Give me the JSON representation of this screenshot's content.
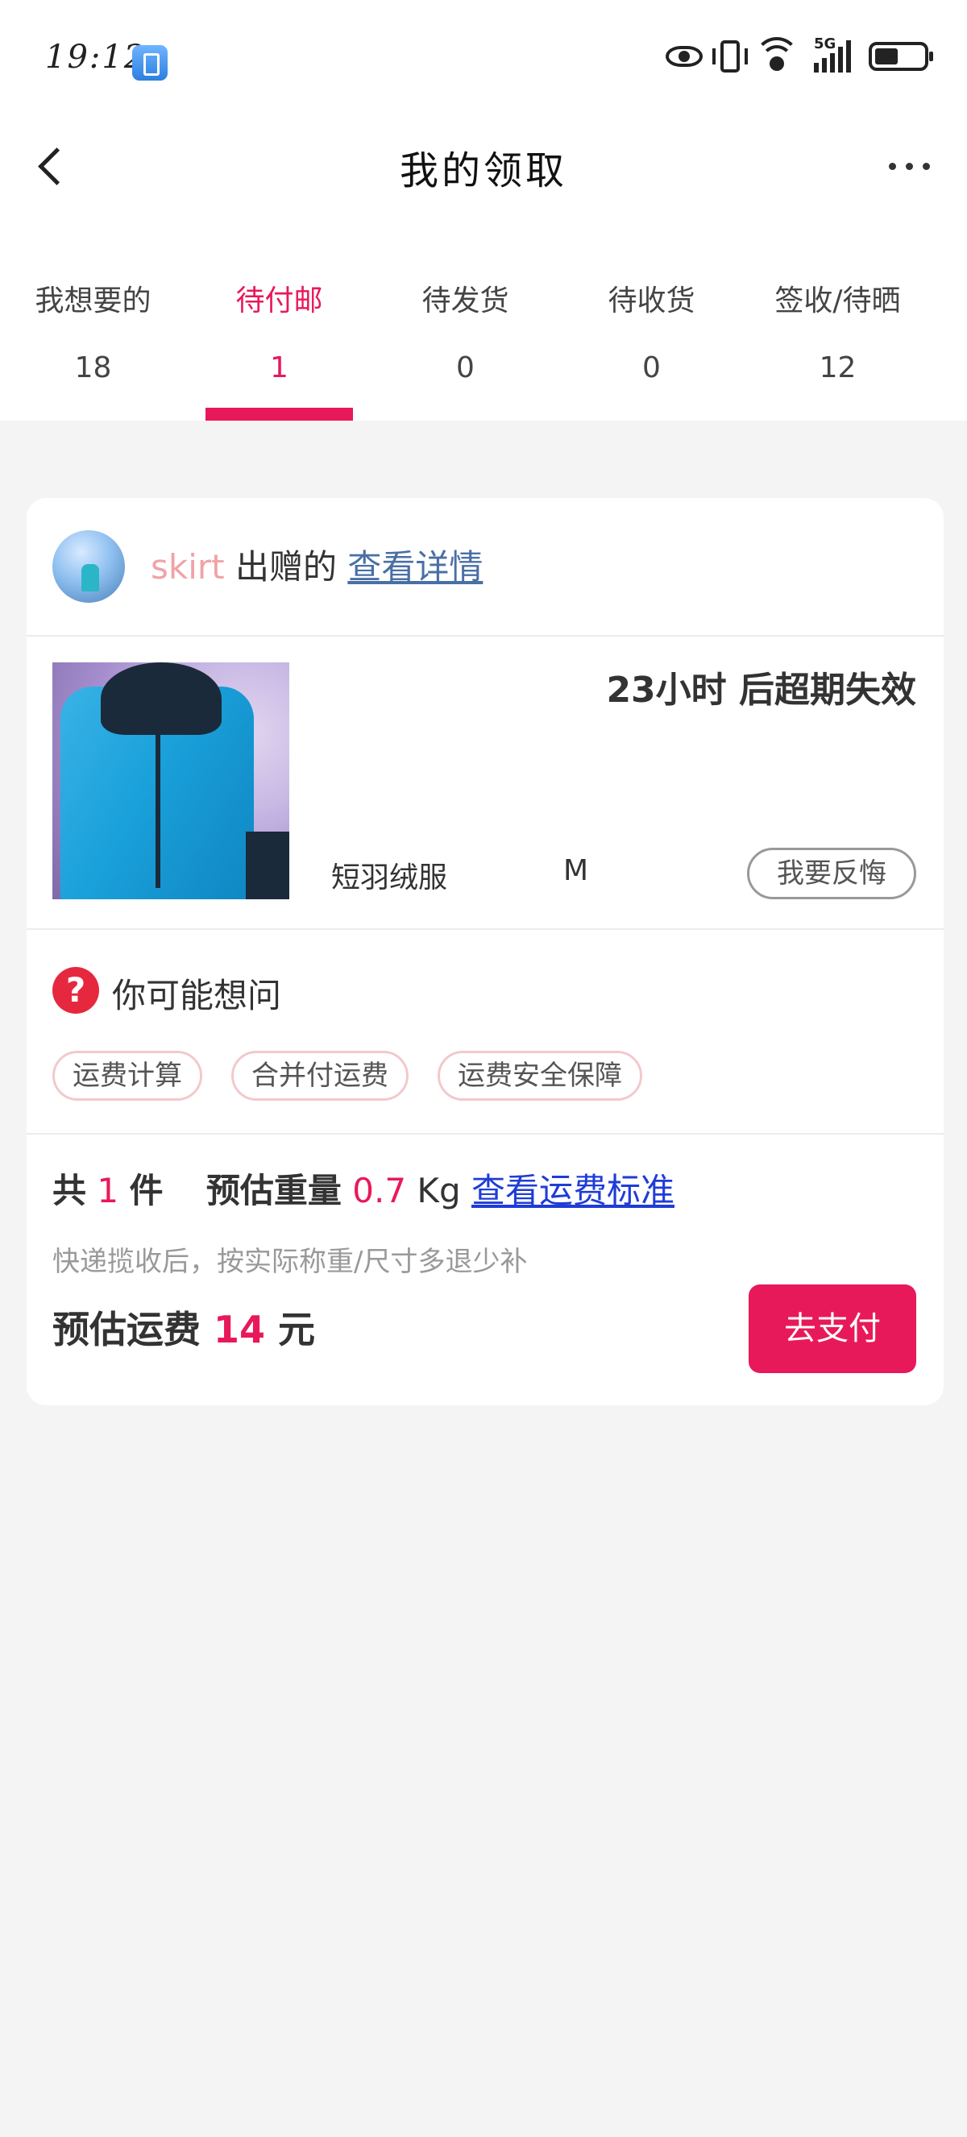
{
  "status_bar": {
    "time": "19:12",
    "network": "5G"
  },
  "nav": {
    "title": "我的领取"
  },
  "tabs": [
    {
      "label": "我想要的",
      "count": "18",
      "active": false
    },
    {
      "label": "待付邮",
      "count": "1",
      "active": true
    },
    {
      "label": "待发货",
      "count": "0",
      "active": false
    },
    {
      "label": "待收货",
      "count": "0",
      "active": false
    },
    {
      "label": "签收/待晒",
      "count": "12",
      "active": false
    }
  ],
  "order": {
    "giver_name": "skirt",
    "giver_suffix": "出赠的",
    "detail_link": "查看详情",
    "expire_text": "23小时 后超期失效",
    "product_name": "短羽绒服",
    "product_size": "M",
    "regret_button": "我要反悔"
  },
  "faq": {
    "title": "你可能想问",
    "chips": [
      "运费计算",
      "合并付运费",
      "运费安全保障"
    ]
  },
  "summary": {
    "count_prefix": "共",
    "count": "1",
    "count_suffix": "件",
    "weight_label": "预估重量",
    "weight_value": "0.7",
    "weight_unit": "Kg",
    "standard_link": "查看运费标准",
    "note": "快递揽收后，按实际称重/尺寸多退少补",
    "fee_label": "预估运费",
    "fee_value": "14",
    "fee_unit": "元",
    "pay_button": "去支付"
  },
  "colors": {
    "accent": "#e8195a",
    "link": "#1f3cd8"
  }
}
